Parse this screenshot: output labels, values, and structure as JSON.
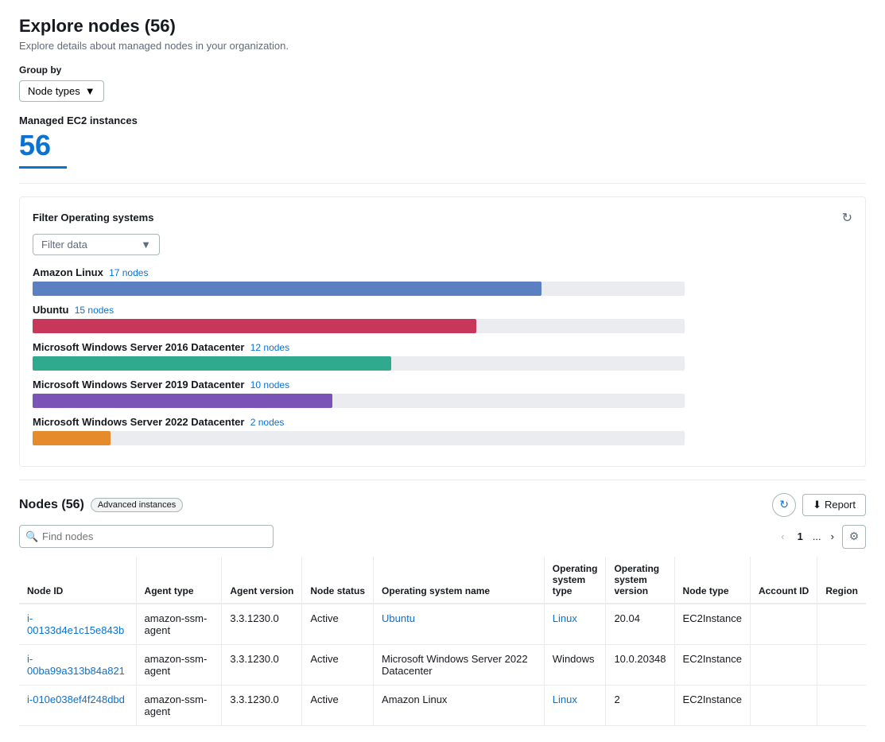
{
  "page": {
    "title": "Explore nodes",
    "title_count": "56",
    "subtitle": "Explore details about managed nodes in your organization."
  },
  "group_by": {
    "label": "Group by",
    "selected": "Node types",
    "icon": "▼"
  },
  "ec2": {
    "label": "Managed EC2 instances",
    "count": "56"
  },
  "filter": {
    "title": "Filter Operating systems",
    "placeholder": "Filter data",
    "icon": "▼"
  },
  "os_bars": [
    {
      "name": "Amazon Linux",
      "count": "17 nodes",
      "color": "#5a80c1",
      "width_pct": 78
    },
    {
      "name": "Ubuntu",
      "count": "15 nodes",
      "color": "#c7375a",
      "width_pct": 68
    },
    {
      "name": "Microsoft Windows Server 2016 Datacenter",
      "count": "12 nodes",
      "color": "#2faa8e",
      "width_pct": 55
    },
    {
      "name": "Microsoft Windows Server 2019 Datacenter",
      "count": "10 nodes",
      "color": "#7b52b5",
      "width_pct": 46
    },
    {
      "name": "Microsoft Windows Server 2022 Datacenter",
      "count": "2 nodes",
      "color": "#e68b2c",
      "width_pct": 12
    }
  ],
  "nodes": {
    "title": "Nodes",
    "count": "56",
    "badge": "Advanced instances",
    "report_label": "Report",
    "search_placeholder": "Find nodes",
    "pagination": {
      "prev": "‹",
      "current": "1",
      "ellipsis": "...",
      "next": "›"
    }
  },
  "table": {
    "columns": [
      {
        "key": "node_id",
        "label": "Node ID"
      },
      {
        "key": "agent_type",
        "label": "Agent type"
      },
      {
        "key": "agent_version",
        "label": "Agent version"
      },
      {
        "key": "node_status",
        "label": "Node status"
      },
      {
        "key": "os_name",
        "label": "Operating system name"
      },
      {
        "key": "os_type",
        "label": "Operating system type"
      },
      {
        "key": "os_version",
        "label": "Operating system version"
      },
      {
        "key": "node_type",
        "label": "Node type"
      },
      {
        "key": "account_id",
        "label": "Account ID"
      },
      {
        "key": "region",
        "label": "Region"
      }
    ],
    "rows": [
      {
        "node_id": "i-00133d4e1c15e843b",
        "agent_type": "amazon-ssm-agent",
        "agent_version": "3.3.1230.0",
        "node_status": "Active",
        "os_name": "Ubuntu",
        "os_name_is_link": true,
        "os_type": "Linux",
        "os_type_is_link": true,
        "os_version": "20.04",
        "node_type": "EC2Instance",
        "account_id": "",
        "region": ""
      },
      {
        "node_id": "i-00ba99a313b84a821",
        "agent_type": "amazon-ssm-agent",
        "agent_version": "3.3.1230.0",
        "node_status": "Active",
        "os_name": "Microsoft Windows Server 2022 Datacenter",
        "os_name_is_link": false,
        "os_type": "Windows",
        "os_type_is_link": false,
        "os_version": "10.0.20348",
        "node_type": "EC2Instance",
        "account_id": "",
        "region": ""
      },
      {
        "node_id": "i-010e038ef4f248dbd",
        "agent_type": "amazon-ssm-agent",
        "agent_version": "3.3.1230.0",
        "node_status": "Active",
        "os_name": "Amazon Linux",
        "os_name_is_link": false,
        "os_type": "Linux",
        "os_type_is_link": true,
        "os_version": "2",
        "node_type": "EC2Instance",
        "account_id": "",
        "region": ""
      }
    ]
  }
}
